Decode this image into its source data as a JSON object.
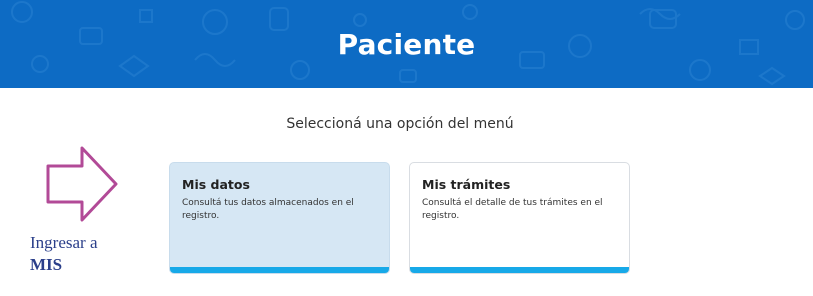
{
  "header": {
    "title": "Paciente",
    "background_color": "#0d6bc4"
  },
  "subtitle": "Seleccioná una opción del menú",
  "cards": [
    {
      "title": "Mis datos",
      "description": "Consultá tus datos almacenados en el registro.",
      "selected": true
    },
    {
      "title": "Mis trámites",
      "description": "Consultá el detalle de tus trámites en el registro.",
      "selected": false
    }
  ],
  "annotation": {
    "line1": "Ingresar a",
    "line2": "MIS",
    "arrow_color": "#b24a97",
    "text_color": "#2b3f8a"
  },
  "accent_color": "#17a9e8"
}
